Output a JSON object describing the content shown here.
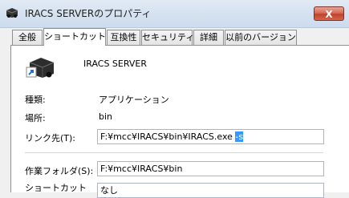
{
  "window": {
    "title": "IRACS SERVERのプロパティ",
    "close_glyph": "X"
  },
  "tabs": [
    {
      "label": "全般"
    },
    {
      "label": "ショートカット",
      "active": true
    },
    {
      "label": "互換性"
    },
    {
      "label": "セキュリティ"
    },
    {
      "label": "詳細"
    },
    {
      "label": "以前のバージョン"
    }
  ],
  "shortcut": {
    "name": "IRACS SERVER",
    "icon": "server-shortcut-icon",
    "type_label": "種類:",
    "type_value": "アプリケーション",
    "location_label": "場所:",
    "location_value": "bin",
    "target_label": "リンク先(T):",
    "target_value": "F:¥mcc¥IRACS¥bin¥IRACS.exe",
    "target_selected": "-s",
    "startin_label": "作業フォルダ(S):",
    "startin_value": "F:¥mcc¥IRACS¥bin",
    "hotkey_label": "ショートカット",
    "hotkey_value": "なし"
  },
  "colors": {
    "selection": "#3399ff",
    "close_button": "#c2412a"
  }
}
